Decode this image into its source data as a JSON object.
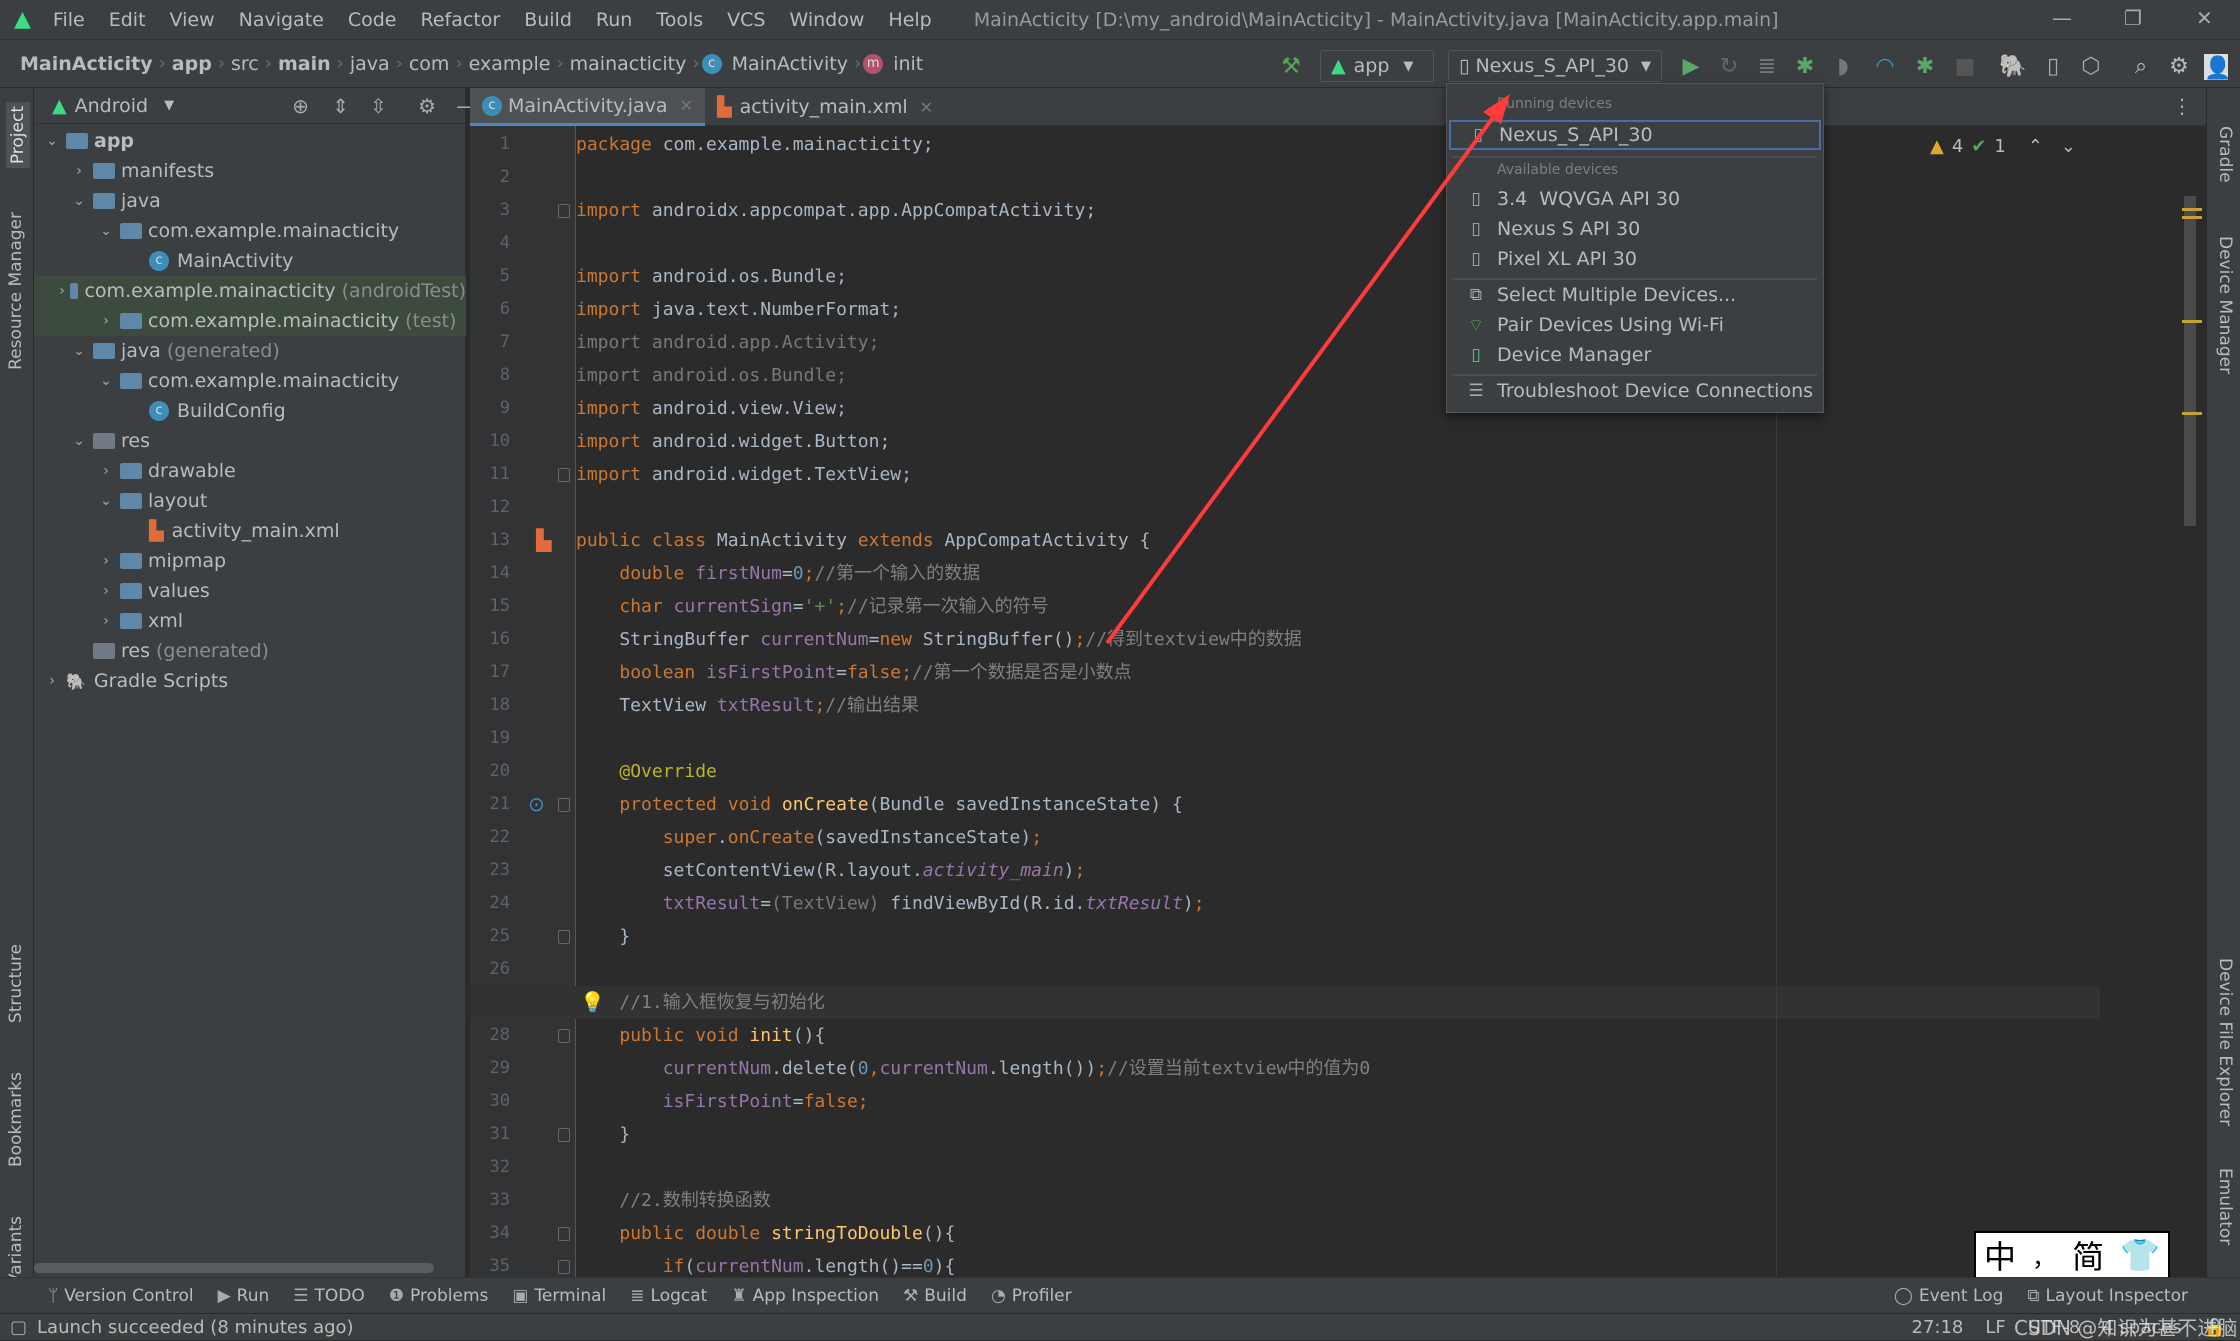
{
  "menubar": {
    "items": [
      "File",
      "Edit",
      "View",
      "Navigate",
      "Code",
      "Refactor",
      "Build",
      "Run",
      "Tools",
      "VCS",
      "Window",
      "Help"
    ],
    "title": "MainActicity [D:\\my_android\\MainActicity] - MainActivity.java [MainActicity.app.main]"
  },
  "breadcrumb": {
    "items": [
      {
        "label": "MainActicity",
        "bold": true
      },
      {
        "label": "app",
        "bold": true
      },
      {
        "label": "src"
      },
      {
        "label": "main",
        "bold": true
      },
      {
        "label": "java"
      },
      {
        "label": "com"
      },
      {
        "label": "example"
      },
      {
        "label": "mainacticity"
      },
      {
        "label": "MainActivity",
        "icon": "C"
      },
      {
        "label": "init",
        "icon": "m"
      }
    ]
  },
  "toolbar": {
    "run_config": "app",
    "device": "Nexus_S_API_30",
    "icons": [
      "hammer-icon",
      "run-icon",
      "apply-changes-icon",
      "apply-code-changes-icon",
      "debug-icon",
      "attach-debugger-icon",
      "profile-icon",
      "debug-attach-icon",
      "stop-icon",
      "gradle-sync-icon",
      "device-manager-icon",
      "sdk-manager-icon",
      "search-icon",
      "settings-icon",
      "avatar"
    ]
  },
  "project": {
    "view": "Android",
    "tree": [
      {
        "level": 0,
        "arrow": "down",
        "icon": "folder-app",
        "label": "app",
        "bold": true
      },
      {
        "level": 1,
        "arrow": "right",
        "icon": "folder",
        "label": "manifests"
      },
      {
        "level": 1,
        "arrow": "down",
        "icon": "folder",
        "label": "java"
      },
      {
        "level": 2,
        "arrow": "down",
        "icon": "package",
        "label": "com.example.mainacticity"
      },
      {
        "level": 3,
        "arrow": "",
        "icon": "class",
        "label": "MainActivity"
      },
      {
        "level": 2,
        "arrow": "right",
        "icon": "package",
        "label": "com.example.mainacticity",
        "suffix": "(androidTest)",
        "selected": true
      },
      {
        "level": 2,
        "arrow": "right",
        "icon": "package",
        "label": "com.example.mainacticity",
        "suffix": "(test)",
        "selected": true
      },
      {
        "level": 1,
        "arrow": "down",
        "icon": "folder-gen",
        "label": "java",
        "suffix": "(generated)"
      },
      {
        "level": 2,
        "arrow": "down",
        "icon": "package",
        "label": "com.example.mainacticity"
      },
      {
        "level": 3,
        "arrow": "",
        "icon": "class",
        "label": "BuildConfig"
      },
      {
        "level": 1,
        "arrow": "down",
        "icon": "folder-res",
        "label": "res"
      },
      {
        "level": 2,
        "arrow": "right",
        "icon": "folder",
        "label": "drawable"
      },
      {
        "level": 2,
        "arrow": "down",
        "icon": "folder",
        "label": "layout"
      },
      {
        "level": 3,
        "arrow": "",
        "icon": "xml",
        "label": "activity_main.xml"
      },
      {
        "level": 2,
        "arrow": "right",
        "icon": "folder",
        "label": "mipmap"
      },
      {
        "level": 2,
        "arrow": "right",
        "icon": "folder",
        "label": "values"
      },
      {
        "level": 2,
        "arrow": "right",
        "icon": "folder",
        "label": "xml"
      },
      {
        "level": 1,
        "arrow": "",
        "icon": "folder-res",
        "label": "res",
        "suffix": "(generated)"
      },
      {
        "level": 0,
        "arrow": "right",
        "icon": "gradle",
        "label": "Gradle Scripts"
      }
    ]
  },
  "left_strip": [
    "Project",
    "Resource Manager",
    "Structure",
    "Bookmarks",
    "Build Variants"
  ],
  "right_strip": [
    "Gradle",
    "Device Manager",
    "Device File Explorer",
    "Emulator"
  ],
  "tabs": [
    {
      "label": "MainActivity.java",
      "icon": "class",
      "active": true
    },
    {
      "label": "activity_main.xml",
      "icon": "xml"
    }
  ],
  "inspections": {
    "warnings": "4",
    "weak_warnings": "1"
  },
  "editor": {
    "current_line": 27,
    "lines": [
      [
        [
          "k",
          "package"
        ],
        [
          "p",
          " com.example.mainacticity;"
        ]
      ],
      [],
      [
        [
          "k",
          "import"
        ],
        [
          "p",
          " androidx.appcompat.app.AppCompatActivity;"
        ]
      ],
      [],
      [
        [
          "k",
          "import"
        ],
        [
          "p",
          " android.os.Bundle;"
        ]
      ],
      [
        [
          "k",
          "import"
        ],
        [
          "p",
          " java.text.NumberFormat;"
        ]
      ],
      [
        [
          "g",
          "import android.app.Activity;"
        ]
      ],
      [
        [
          "g",
          "import android.os.Bundle;"
        ]
      ],
      [
        [
          "k",
          "import"
        ],
        [
          "p",
          " android.view.View;"
        ]
      ],
      [
        [
          "k",
          "import"
        ],
        [
          "p",
          " android.widget.Button;"
        ]
      ],
      [
        [
          "k",
          "import"
        ],
        [
          "p",
          " android.widget.TextView;"
        ]
      ],
      [],
      [
        [
          "k",
          "public class"
        ],
        [
          "p",
          " MainActivity "
        ],
        [
          "k",
          "extends"
        ],
        [
          "p",
          " AppCompatActivity {"
        ]
      ],
      [
        [
          "p",
          "    "
        ],
        [
          "k",
          "double"
        ],
        [
          "p",
          " "
        ],
        [
          "f",
          "firstNum"
        ],
        [
          "p",
          "="
        ],
        [
          "n",
          "0"
        ],
        [
          "k",
          ";"
        ],
        [
          "c",
          "//第一个输入的数据"
        ]
      ],
      [
        [
          "p",
          "    "
        ],
        [
          "k",
          "char"
        ],
        [
          "p",
          " "
        ],
        [
          "f",
          "currentSign"
        ],
        [
          "p",
          "="
        ],
        [
          "s",
          "'+'"
        ],
        [
          "k",
          ";"
        ],
        [
          "c",
          "//记录第一次输入的符号"
        ]
      ],
      [
        [
          "p",
          "    StringBuffer "
        ],
        [
          "f",
          "currentNum"
        ],
        [
          "p",
          "="
        ],
        [
          "k",
          "new"
        ],
        [
          "p",
          " StringBuffer()"
        ],
        [
          "k",
          ";"
        ],
        [
          "c",
          "//得到textview中的数据"
        ]
      ],
      [
        [
          "p",
          "    "
        ],
        [
          "k",
          "boolean"
        ],
        [
          "p",
          " "
        ],
        [
          "f",
          "isFirstPoint"
        ],
        [
          "p",
          "="
        ],
        [
          "k",
          "false;"
        ],
        [
          "c",
          "//第一个数据是否是小数点"
        ]
      ],
      [
        [
          "p",
          "    TextView "
        ],
        [
          "f",
          "txtResult"
        ],
        [
          "k",
          ";"
        ],
        [
          "c",
          "//输出结果"
        ]
      ],
      [],
      [
        [
          "p",
          "    "
        ],
        [
          "a",
          "@Override"
        ]
      ],
      [
        [
          "p",
          "    "
        ],
        [
          "k",
          "protected void"
        ],
        [
          "p",
          " "
        ],
        [
          "m",
          "onCreate"
        ],
        [
          "p",
          "(Bundle savedInstanceState) {"
        ]
      ],
      [
        [
          "p",
          "        "
        ],
        [
          "k",
          "super"
        ],
        [
          "p",
          "."
        ],
        [
          "k",
          "onCreate"
        ],
        [
          "p",
          "(savedInstanceState)"
        ],
        [
          "k",
          ";"
        ]
      ],
      [
        [
          "p",
          "        setContentView(R.layout."
        ],
        [
          "fi",
          "activity_main"
        ],
        [
          "p",
          ")"
        ],
        [
          "k",
          ";"
        ]
      ],
      [
        [
          "p",
          "        "
        ],
        [
          "f",
          "txtResult"
        ],
        [
          "p",
          "="
        ],
        [
          "g",
          "(TextView)"
        ],
        [
          "p",
          " findViewById(R.id."
        ],
        [
          "fi",
          "txtResult"
        ],
        [
          "p",
          ")"
        ],
        [
          "k",
          ";"
        ]
      ],
      [
        [
          "p",
          "    }"
        ]
      ],
      [],
      [
        [
          "p",
          "    "
        ],
        [
          "c",
          "//1.输入框恢复与初始化"
        ]
      ],
      [
        [
          "p",
          "    "
        ],
        [
          "k",
          "public void"
        ],
        [
          "p",
          " "
        ],
        [
          "m",
          "init"
        ],
        [
          "p",
          "(){"
        ]
      ],
      [
        [
          "p",
          "        "
        ],
        [
          "f",
          "currentNum"
        ],
        [
          "p",
          ".delete("
        ],
        [
          "n",
          "0"
        ],
        [
          "k",
          ","
        ],
        [
          "f",
          "currentNum"
        ],
        [
          "p",
          ".length())"
        ],
        [
          "k",
          ";"
        ],
        [
          "c",
          "//设置当前textview中的值为0"
        ]
      ],
      [
        [
          "p",
          "        "
        ],
        [
          "f",
          "isFirstPoint"
        ],
        [
          "p",
          "="
        ],
        [
          "k",
          "false;"
        ]
      ],
      [
        [
          "p",
          "    }"
        ]
      ],
      [],
      [
        [
          "p",
          "    "
        ],
        [
          "c",
          "//2.数制转换函数"
        ]
      ],
      [
        [
          "p",
          "    "
        ],
        [
          "k",
          "public double"
        ],
        [
          "p",
          " "
        ],
        [
          "m",
          "stringToDouble"
        ],
        [
          "p",
          "(){"
        ]
      ],
      [
        [
          "p",
          "        "
        ],
        [
          "k",
          "if"
        ],
        [
          "p",
          "("
        ],
        [
          "f",
          "currentNum"
        ],
        [
          "p",
          ".length()=="
        ],
        [
          "n",
          "0"
        ],
        [
          "p",
          "){"
        ]
      ]
    ]
  },
  "device_dropdown": {
    "running_header": "Running devices",
    "running": [
      "Nexus_S_API_30"
    ],
    "available_header": "Available devices",
    "available": [
      "3.4  WQVGA API 30",
      "Nexus S API 30",
      "Pixel XL API 30"
    ],
    "actions": [
      "Select Multiple Devices...",
      "Pair Devices Using Wi-Fi",
      "Device Manager"
    ],
    "troubleshoot": "Troubleshoot Device Connections"
  },
  "bottom_tools": {
    "left": [
      {
        "label": "Version Control",
        "icon": "version-control-icon",
        "glyph": "ᛘ"
      },
      {
        "label": "Run",
        "icon": "run-icon",
        "glyph": "▶"
      },
      {
        "label": "TODO",
        "icon": "todo-icon",
        "glyph": "☰"
      },
      {
        "label": "Problems",
        "icon": "problems-icon",
        "glyph": "❶"
      },
      {
        "label": "Terminal",
        "icon": "terminal-icon",
        "glyph": "▣"
      },
      {
        "label": "Logcat",
        "icon": "logcat-icon",
        "glyph": "≣"
      },
      {
        "label": "App Inspection",
        "icon": "app-inspection-icon",
        "glyph": "♜"
      },
      {
        "label": "Build",
        "icon": "build-icon",
        "glyph": "⚒"
      },
      {
        "label": "Profiler",
        "icon": "profiler-icon",
        "glyph": "◔"
      }
    ],
    "right": [
      {
        "label": "Event Log",
        "icon": "event-log-icon",
        "glyph": "◯"
      },
      {
        "label": "Layout Inspector",
        "icon": "layout-inspector-icon",
        "glyph": "⧉"
      }
    ]
  },
  "status": {
    "message": "Launch succeeded (8 minutes ago)",
    "position": "27:18",
    "line_sep": "LF",
    "encoding": "UTF-8",
    "indent": "4 spaces",
    "watermark": "CSDN @知识为甚不进脑"
  },
  "ime": {
    "lang": "中",
    "punct": "，",
    "mode": "简"
  },
  "colors": {
    "accent": "#4a88c7",
    "keyword": "#cc7832",
    "comment": "#808080",
    "annotation_arrow": "#ff3b3b",
    "android_green": "#3ddc84"
  }
}
